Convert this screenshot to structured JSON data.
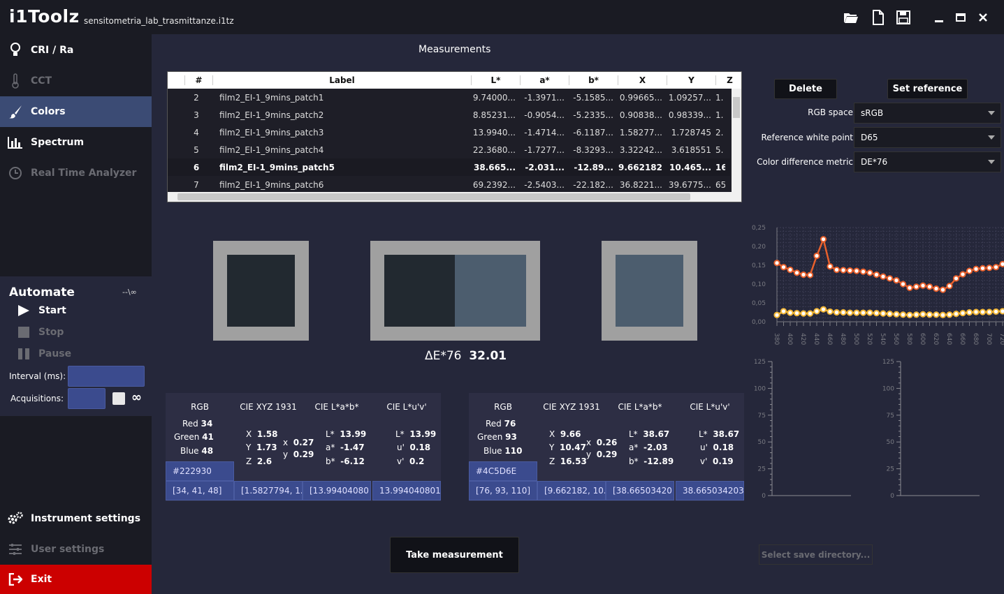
{
  "app": {
    "title": "i1Toolz",
    "file": "sensitometria_lab_trasmittanze.i1tz"
  },
  "toolbar": {
    "icons": [
      "folder-open-icon",
      "new-file-icon",
      "save-icon",
      "minimize-icon",
      "maximize-icon",
      "close-icon"
    ]
  },
  "sidebar": {
    "items": [
      {
        "label": "CRI / Ra",
        "icon": "bulb-icon"
      },
      {
        "label": "CCT",
        "icon": "thermometer-icon"
      },
      {
        "label": "Colors",
        "icon": "brush-icon"
      },
      {
        "label": "Spectrum",
        "icon": "bar-chart-icon"
      },
      {
        "label": "Real Time Analyzer",
        "icon": "clock-icon"
      }
    ],
    "automate": {
      "title": "Automate",
      "count": "--\\∞",
      "start": "Start",
      "stop": "Stop",
      "pause": "Pause",
      "interval_label": "Interval (ms):",
      "acquisitions_label": "Acquisitions:",
      "infinity": "∞"
    },
    "bottom": {
      "instrument": "Instrument settings",
      "user": "User settings",
      "exit": "Exit"
    }
  },
  "main": {
    "title": "Measurements",
    "table": {
      "headers": [
        "#",
        "Label",
        "L*",
        "a*",
        "b*",
        "X",
        "Y",
        "Z"
      ],
      "rows": [
        [
          "2",
          "film2_EI-1_9mins_patch1",
          "9.74000...",
          "-1.3971...",
          "-5.1585...",
          "0.99665...",
          "1.09257...",
          "1."
        ],
        [
          "3",
          "film2_EI-1_9mins_patch2",
          "8.85231...",
          "-0.9054...",
          "-5.2335...",
          "0.90838...",
          "0.98339...",
          "1."
        ],
        [
          "4",
          "film2_EI-1_9mins_patch3",
          "13.9940...",
          "-1.4714...",
          "-6.1187...",
          "1.58277...",
          "1.728745",
          "2."
        ],
        [
          "5",
          "film2_EI-1_9mins_patch4",
          "22.3680...",
          "-1.7277...",
          "-8.3293...",
          "3.32242...",
          "3.618551",
          "5."
        ],
        [
          "6",
          "film2_EI-1_9mins_patch5",
          "38.665...",
          "-2.031...",
          "-12.89...",
          "9.662182",
          "10.465...",
          "16"
        ],
        [
          "7",
          "film2_EI-1_9mins_patch6",
          "69.2392...",
          "-2.5403...",
          "-22.182...",
          "36.8221...",
          "39.6775...",
          "65"
        ]
      ]
    },
    "delta": {
      "label": "ΔE*76",
      "value": "32.01"
    },
    "take_button": "Take measurement"
  },
  "controls": {
    "delete": "Delete",
    "set_reference": "Set reference",
    "rgb_space_label": "RGB space",
    "rgb_space": "sRGB",
    "white_point_label": "Reference white point",
    "white_point": "D65",
    "metric_label": "Color difference metric",
    "metric": "DE*76",
    "save_dir": "Select save directory..."
  },
  "colors": {
    "sample1": "#222930",
    "sample2": "#4C5D6E",
    "frame": "#a0a0a0",
    "line_orange": "#e8602c",
    "line_yellow": "#f2b636"
  },
  "panel1": {
    "heads": [
      "RGB",
      "CIE XYZ 1931",
      "CIE L*a*b*",
      "CIE L*u'v'"
    ],
    "rgb": {
      "r_label": "Red",
      "r": "34",
      "g_label": "Green",
      "g": "41",
      "b_label": "Blue",
      "b": "48"
    },
    "xyz": {
      "X": "1.58",
      "Y": "1.73",
      "Z": "2.6",
      "x": "0.27",
      "y": "0.29"
    },
    "lab": {
      "L": "13.99",
      "a": "-1.47",
      "b": "-6.12"
    },
    "luv": {
      "L": "13.99",
      "u": "0.18",
      "v": "0.2"
    },
    "hex": "#222930",
    "copy": [
      "[34, 41, 48]",
      "[1.5827794, 1.",
      "[13.99404080",
      "13.994040801"
    ]
  },
  "panel2": {
    "heads": [
      "RGB",
      "CIE XYZ 1931",
      "CIE L*a*b*",
      "CIE L*u'v'"
    ],
    "rgb": {
      "r_label": "Red",
      "r": "76",
      "g_label": "Green",
      "g": "93",
      "b_label": "Blue",
      "b": "110"
    },
    "xyz": {
      "X": "9.66",
      "Y": "10.47",
      "Z": "16.53",
      "x": "0.26",
      "y": "0.29"
    },
    "lab": {
      "L": "38.67",
      "a": "-2.03",
      "b": "-12.89"
    },
    "luv": {
      "L": "38.67",
      "u": "0.18",
      "v": "0.19"
    },
    "hex": "#4C5D6E",
    "copy": [
      "[76, 93, 110]",
      "[9.662182, 10.",
      "[38.66503420",
      "38.665034203"
    ]
  },
  "chart_data": [
    {
      "type": "line",
      "x": [
        380,
        390,
        400,
        410,
        420,
        430,
        440,
        450,
        460,
        470,
        480,
        490,
        500,
        510,
        520,
        530,
        540,
        550,
        560,
        570,
        580,
        590,
        600,
        610,
        620,
        630,
        640,
        650,
        660,
        670,
        680,
        690,
        700,
        710,
        720
      ],
      "series": [
        {
          "values": [
            0.156,
            0.145,
            0.138,
            0.13,
            0.125,
            0.124,
            0.175,
            0.219,
            0.147,
            0.138,
            0.137,
            0.136,
            0.135,
            0.133,
            0.13,
            0.125,
            0.12,
            0.115,
            0.11,
            0.1,
            0.09,
            0.093,
            0.096,
            0.093,
            0.088,
            0.085,
            0.095,
            0.115,
            0.126,
            0.135,
            0.14,
            0.142,
            0.143,
            0.145,
            0.153
          ]
        },
        {
          "values": [
            0.018,
            0.028,
            0.024,
            0.023,
            0.022,
            0.022,
            0.028,
            0.033,
            0.027,
            0.025,
            0.025,
            0.024,
            0.024,
            0.024,
            0.024,
            0.023,
            0.022,
            0.021,
            0.02,
            0.019,
            0.018,
            0.019,
            0.02,
            0.019,
            0.019,
            0.018,
            0.019,
            0.021,
            0.023,
            0.025,
            0.026,
            0.026,
            0.026,
            0.027,
            0.028
          ]
        }
      ],
      "ylim": [
        0,
        0.25
      ],
      "y_ticks": [
        "0,00",
        "0,05",
        "0,10",
        "0,15",
        "0,20",
        "0,25"
      ],
      "x_ticks": [
        "380",
        "400",
        "420",
        "440",
        "460",
        "480",
        "500",
        "520",
        "540",
        "560",
        "580",
        "600",
        "620",
        "640",
        "660",
        "680",
        "700",
        "720"
      ]
    },
    {
      "type": "bar",
      "values": [],
      "ylim": [
        0,
        125
      ],
      "y_ticks": [
        "0",
        "25",
        "50",
        "75",
        "100",
        "125"
      ]
    },
    {
      "type": "bar",
      "values": [],
      "ylim": [
        0,
        125
      ],
      "y_ticks": [
        "0",
        "25",
        "50",
        "75",
        "100",
        "125"
      ]
    }
  ]
}
